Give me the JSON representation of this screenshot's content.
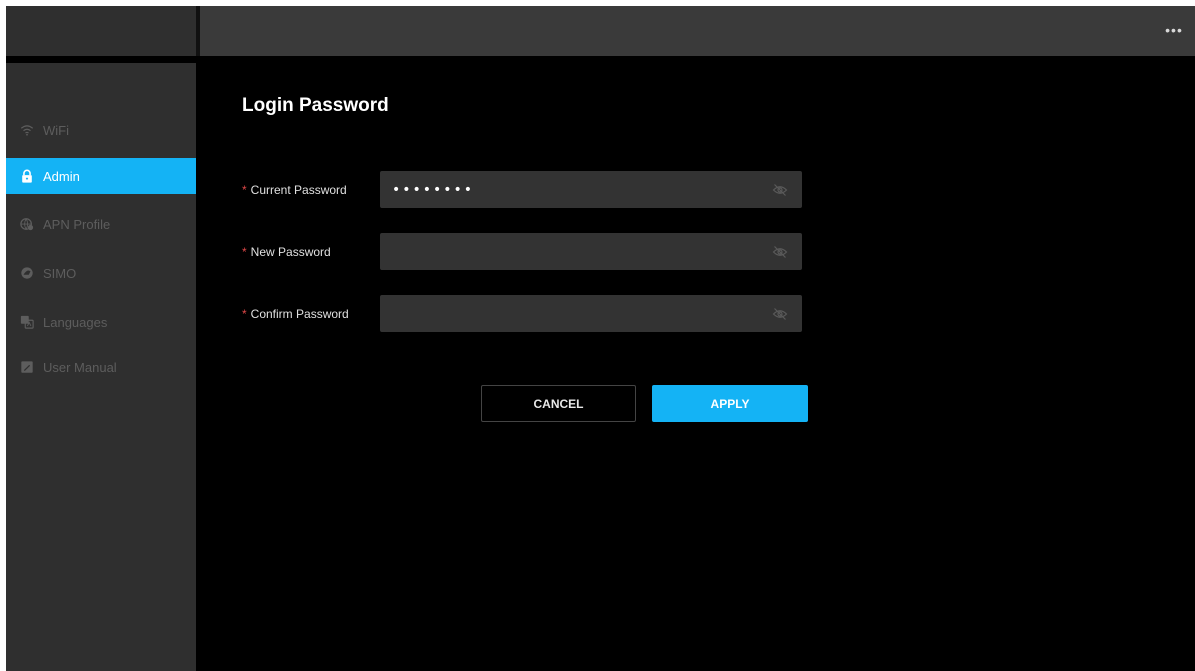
{
  "header": {
    "more_label": "•••"
  },
  "sidebar": {
    "items": [
      {
        "label": "WiFi",
        "icon": "wifi-icon",
        "active": false
      },
      {
        "label": "Admin",
        "icon": "lock-icon",
        "active": true
      },
      {
        "label": "APN Profile",
        "icon": "apn-profile-icon",
        "active": false
      },
      {
        "label": "SIMO",
        "icon": "simo-icon",
        "active": false
      },
      {
        "label": "Languages",
        "icon": "languages-icon",
        "active": false
      },
      {
        "label": "User Manual",
        "icon": "user-manual-icon",
        "active": false
      }
    ]
  },
  "main": {
    "title": "Login Password",
    "required_mark": "*",
    "fields": [
      {
        "label": "Current Password",
        "value": "********",
        "placeholder": ""
      },
      {
        "label": "New Password",
        "value": "",
        "placeholder": ""
      },
      {
        "label": "Confirm Password",
        "value": "",
        "placeholder": ""
      }
    ],
    "cancel_label": "CANCEL",
    "apply_label": "APPLY"
  },
  "colors": {
    "accent": "#14b3f5",
    "background": "#000000",
    "sidebar": "#2f2f2f",
    "topbar": "#3a3a3a",
    "input": "#333333",
    "required": "#e04848"
  }
}
